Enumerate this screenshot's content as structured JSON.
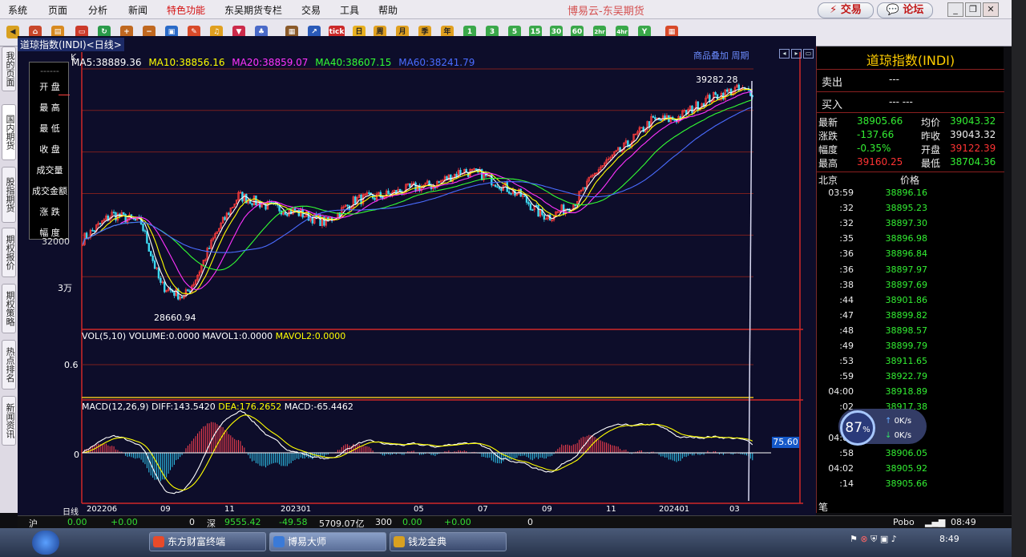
{
  "menubar": {
    "items": [
      "系统",
      "页面",
      "分析",
      "新闻",
      "特色功能",
      "东吴期货专栏",
      "交易",
      "工具",
      "帮助"
    ],
    "highlight_index": 4,
    "window_title": "博易云-东吴期货",
    "trade_button": "交易",
    "forum_button": "论坛"
  },
  "toolbar": {
    "period_buttons": [
      "日",
      "周",
      "月",
      "季",
      "年",
      "1",
      "3",
      "5",
      "15",
      "30",
      "60",
      "2hr",
      "4hr",
      "Y"
    ],
    "tick_label": "tick"
  },
  "sidetabs": [
    "我的页面",
    "国内期货",
    "股指期货",
    "期权报价",
    "期权策略",
    "热点排名",
    "新闻资讯"
  ],
  "chart": {
    "view_title": "道琼指数(INDI)<日线>",
    "k_label": "K",
    "ma": [
      {
        "label": "MA5:38889.36",
        "color": "#ffffff"
      },
      {
        "label": "MA10:38856.16",
        "color": "#ffff00"
      },
      {
        "label": "MA20:38859.07",
        "color": "#ff33ff"
      },
      {
        "label": "MA40:38607.15",
        "color": "#33ff33"
      },
      {
        "label": "MA60:38241.79",
        "color": "#4a6cff"
      }
    ],
    "links": "商品叠加   周期",
    "info_menu": [
      "------",
      "开 盘",
      "最 高",
      "最 低",
      "收 盘",
      "成交量",
      "成交金额",
      "涨 跌",
      "幅 度"
    ],
    "high_label": "39282.28",
    "low_label": "28660.94",
    "y_unit": "3万",
    "y_32k": "32000",
    "vol_parts": [
      {
        "text": "VOL(5,10) VOLUME:0.0000 MAVOL1:0.0000 ",
        "color": "#ffffff"
      },
      {
        "text": "MAVOL2:0.0000",
        "color": "#ffff00"
      }
    ],
    "vol_axis": "0.6",
    "macd_parts": [
      {
        "text": "MACD(12,26,9) DIFF:143.5420 ",
        "color": "#ffffff"
      },
      {
        "text": "DEA:176.2652",
        "color": "#ffff00"
      },
      {
        "text": " MACD:-65.4462",
        "color": "#ffffff"
      }
    ],
    "macd_axis": "0",
    "macd_current": "75.60",
    "x_ticks": [
      "日线",
      "202206",
      "09",
      "11",
      "202301",
      "05",
      "07",
      "09",
      "11",
      "202401",
      "03"
    ]
  },
  "chart_data": {
    "type": "line",
    "title": "道琼指数(INDI)<日线>",
    "x": [
      "202206",
      "09",
      "11",
      "202301",
      "05",
      "07",
      "09",
      "11",
      "202401",
      "03"
    ],
    "series": [
      {
        "name": "MA5",
        "values": [
          31500,
          29500,
          33500,
          33800,
          33400,
          34400,
          34300,
          32900,
          37700,
          38890
        ]
      },
      {
        "name": "MA60",
        "values": [
          31900,
          31400,
          31400,
          33300,
          33700,
          33600,
          34600,
          33800,
          35900,
          38240
        ]
      }
    ],
    "high": 39282.28,
    "low": 28660.94,
    "ylim": [
      27500,
      40500
    ],
    "grid": true
  },
  "quote": {
    "title": "道琼指数(INDI)",
    "sell_label": "卖出",
    "sell_value": "---",
    "buy_label": "买入",
    "buy_value": "---  ---",
    "rows": [
      {
        "l1": "最新",
        "v1": "38905.66",
        "c1": "#33ee33",
        "l2": "均价",
        "v2": "39043.32",
        "c2": "#33ee33"
      },
      {
        "l1": "涨跌",
        "v1": "-137.66",
        "c1": "#33ee33",
        "l2": "昨收",
        "v2": "39043.32",
        "c2": "#eeeeee"
      },
      {
        "l1": "幅度",
        "v1": "-0.35%",
        "c1": "#33ee33",
        "l2": "开盘",
        "v2": "39122.39",
        "c2": "#ff3333"
      },
      {
        "l1": "最高",
        "v1": "39160.25",
        "c1": "#ff3333",
        "l2": "最低",
        "v2": "38704.36",
        "c2": "#33ee33"
      }
    ],
    "tick_header_left": "北京",
    "tick_header_right": "价格",
    "ticks": [
      {
        "t": "03:59",
        "p": "38896.16"
      },
      {
        "t": ":32",
        "p": "38895.23"
      },
      {
        "t": ":32",
        "p": "38897.30"
      },
      {
        "t": ":35",
        "p": "38896.98"
      },
      {
        "t": ":36",
        "p": "38896.84"
      },
      {
        "t": ":36",
        "p": "38897.97"
      },
      {
        "t": ":38",
        "p": "38897.69"
      },
      {
        "t": ":44",
        "p": "38901.86"
      },
      {
        "t": ":47",
        "p": "38899.82"
      },
      {
        "t": ":48",
        "p": "38898.57"
      },
      {
        "t": ":49",
        "p": "38899.79"
      },
      {
        "t": ":53",
        "p": "38911.65"
      },
      {
        "t": ":59",
        "p": "38922.79"
      },
      {
        "t": "04:00",
        "p": "38918.89"
      },
      {
        "t": ":02",
        "p": "38917.38"
      },
      {
        "t": ":03",
        "p": ""
      },
      {
        "t": "04:01",
        "p": ""
      },
      {
        "t": ":58",
        "p": "38906.05"
      },
      {
        "t": "04:02",
        "p": "38905.92"
      },
      {
        "t": ":14",
        "p": "38905.66"
      }
    ],
    "bottom_label": "笔"
  },
  "net_widget": {
    "percent": "87",
    "unit": "%",
    "up": "0K/s",
    "down": "0K/s"
  },
  "statusbar": {
    "items": [
      "沪",
      "0.00",
      "+0.00",
      "0",
      "深",
      "9555.42",
      "-49.58",
      "5709.07亿",
      "300",
      "0.00",
      "+0.00",
      "0",
      "Pobo",
      "08:49"
    ]
  },
  "taskbar": {
    "tasks": [
      "东方财富终端",
      "博易大师",
      "钱龙金典"
    ],
    "clock": "8:49"
  }
}
